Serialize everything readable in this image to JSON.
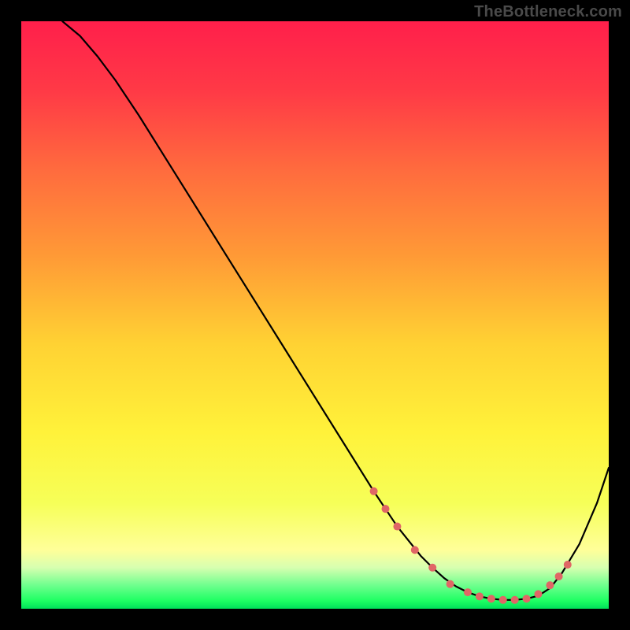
{
  "watermark": "TheBottleneck.com",
  "chart_data": {
    "type": "line",
    "title": "",
    "xlabel": "",
    "ylabel": "",
    "xlim": [
      0,
      100
    ],
    "ylim": [
      0,
      100
    ],
    "grid": false,
    "curve": {
      "name": "bottleneck-curve",
      "x": [
        7,
        10,
        13,
        16,
        20,
        25,
        30,
        35,
        40,
        45,
        50,
        55,
        60,
        62,
        64,
        66,
        68,
        70,
        72,
        74,
        76,
        78,
        80,
        82,
        84,
        86,
        88,
        90,
        92,
        95,
        98,
        100
      ],
      "y": [
        100,
        97.5,
        94,
        90,
        84,
        76,
        68,
        60,
        52,
        44,
        36,
        28,
        20,
        17,
        14,
        11.5,
        9,
        7,
        5.2,
        3.8,
        2.8,
        2.1,
        1.7,
        1.5,
        1.5,
        1.7,
        2.2,
        3.5,
        6,
        11,
        18,
        24
      ]
    },
    "highlight_dots": {
      "name": "sweet-spot-markers",
      "color": "#e06666",
      "points": [
        {
          "x": 60,
          "y": 20
        },
        {
          "x": 62,
          "y": 17
        },
        {
          "x": 64,
          "y": 14
        },
        {
          "x": 67,
          "y": 10
        },
        {
          "x": 70,
          "y": 7
        },
        {
          "x": 73,
          "y": 4.2
        },
        {
          "x": 76,
          "y": 2.8
        },
        {
          "x": 78,
          "y": 2.1
        },
        {
          "x": 80,
          "y": 1.7
        },
        {
          "x": 82,
          "y": 1.5
        },
        {
          "x": 84,
          "y": 1.5
        },
        {
          "x": 86,
          "y": 1.7
        },
        {
          "x": 88,
          "y": 2.5
        },
        {
          "x": 90,
          "y": 4
        },
        {
          "x": 91.5,
          "y": 5.5
        },
        {
          "x": 93,
          "y": 7.5
        }
      ]
    },
    "gradient_stops": [
      {
        "offset": 0,
        "color": "#ff1f4b"
      },
      {
        "offset": 12,
        "color": "#ff3a46"
      },
      {
        "offset": 25,
        "color": "#ff6a3e"
      },
      {
        "offset": 40,
        "color": "#ff9a36"
      },
      {
        "offset": 55,
        "color": "#ffd233"
      },
      {
        "offset": 70,
        "color": "#fff23a"
      },
      {
        "offset": 82,
        "color": "#f6ff58"
      },
      {
        "offset": 90,
        "color": "#ffff99"
      },
      {
        "offset": 93,
        "color": "#d7ffb0"
      },
      {
        "offset": 96,
        "color": "#6fff8e"
      },
      {
        "offset": 98.7,
        "color": "#1cff62"
      },
      {
        "offset": 100,
        "color": "#00e05a"
      }
    ]
  }
}
